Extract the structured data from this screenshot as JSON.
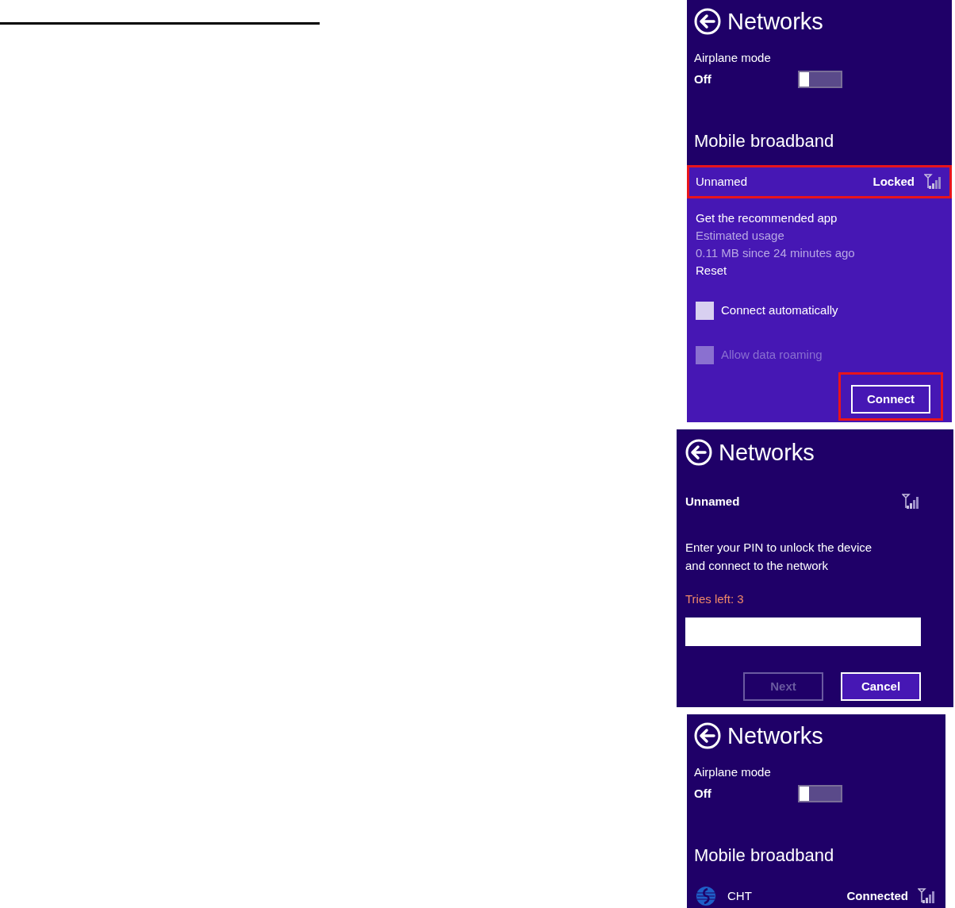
{
  "panels": [
    {
      "kind": "network_list",
      "title": "Networks",
      "airplane": {
        "label": "Airplane mode",
        "value": "Off",
        "on": false
      },
      "section": "Mobile broadband",
      "network": {
        "name": "Unnamed",
        "status": "Locked",
        "logo": false,
        "selected": true,
        "highlighted": true
      },
      "details": {
        "link": "Get the recommended app",
        "usage_label": "Estimated usage",
        "usage": "0.11 MB since 24 minutes ago",
        "reset": "Reset"
      },
      "options": [
        {
          "label": "Connect automatically",
          "checked": false,
          "disabled": false
        },
        {
          "label": "Allow data roaming",
          "checked": false,
          "disabled": true
        }
      ],
      "button": {
        "label": "Connect",
        "highlighted": true
      }
    },
    {
      "kind": "pin",
      "title": "Networks",
      "network": "Unnamed",
      "message": "Enter your PIN to unlock the device and connect to the network",
      "tries": "Tries left: 3",
      "buttons": [
        {
          "label": "Next",
          "disabled": true
        },
        {
          "label": "Cancel",
          "disabled": false
        }
      ]
    },
    {
      "kind": "network_list",
      "title": "Networks",
      "airplane": {
        "label": "Airplane mode",
        "value": "Off",
        "on": false
      },
      "section": "Mobile broadband",
      "network": {
        "name": "CHT",
        "status": "Connected",
        "logo": true,
        "selected": false,
        "highlighted": false
      }
    }
  ]
}
